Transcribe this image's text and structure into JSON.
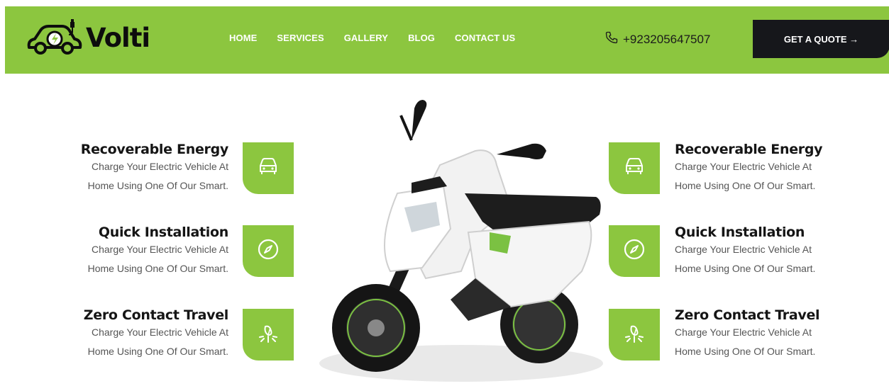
{
  "brand": {
    "name": "Volti",
    "logo_icon": "electric-car-plug-icon"
  },
  "nav": {
    "items": [
      "HOME",
      "SERVICES",
      "GALLERY",
      "BLOG",
      "CONTACT US"
    ]
  },
  "contact": {
    "phone": "+923205647507",
    "phone_icon": "phone-icon"
  },
  "cta": {
    "label": "GET A QUOTE →"
  },
  "features_left": [
    {
      "title": "Recoverable Energy",
      "line1": "Charge Your Electric Vehicle At",
      "line2": "Home Using One Of Our Smart.",
      "icon": "car-icon"
    },
    {
      "title": "Quick Installation",
      "line1": "Charge Your Electric Vehicle At",
      "line2": "Home Using One Of Our Smart.",
      "icon": "compass-icon"
    },
    {
      "title": "Zero Contact Travel",
      "line1": "Charge Your Electric Vehicle At",
      "line2": "Home Using One Of Our Smart.",
      "icon": "leaf-sprout-icon"
    }
  ],
  "features_right": [
    {
      "title": "Recoverable Energy",
      "line1": "Charge Your Electric Vehicle At",
      "line2": "Home Using One Of Our Smart.",
      "icon": "car-icon"
    },
    {
      "title": "Quick Installation",
      "line1": "Charge Your Electric Vehicle At",
      "line2": "Home Using One Of Our Smart.",
      "icon": "compass-icon"
    },
    {
      "title": "Zero Contact Travel",
      "line1": "Charge Your Electric Vehicle At",
      "line2": "Home Using One Of Our Smart.",
      "icon": "leaf-sprout-icon"
    }
  ],
  "colors": {
    "accent": "#8cc63f",
    "dark": "#16171b",
    "heading": "#151515",
    "body_text": "#555555"
  }
}
